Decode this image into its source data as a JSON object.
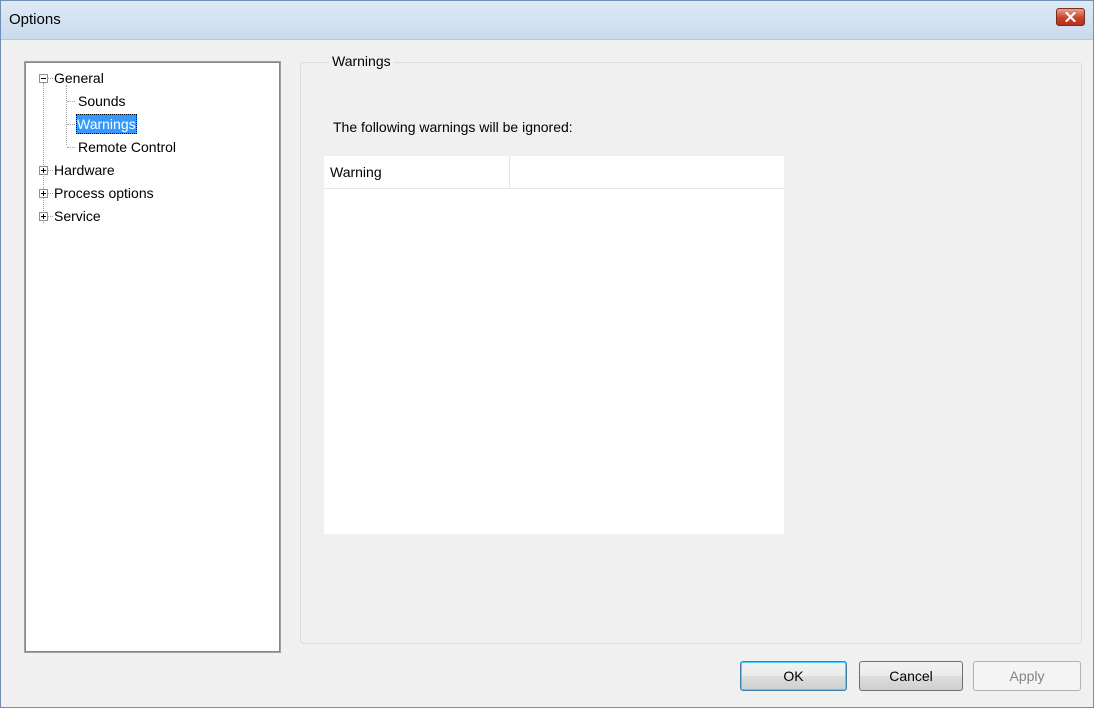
{
  "window": {
    "title": "Options"
  },
  "icons": {
    "close": "close-icon",
    "expand": "plus-box-icon",
    "collapse": "minus-box-icon"
  },
  "tree": {
    "items": [
      {
        "label": "General",
        "level": 0,
        "state": "expanded"
      },
      {
        "label": "Sounds",
        "level": 1
      },
      {
        "label": "Warnings",
        "level": 1,
        "selected": true
      },
      {
        "label": "Remote Control",
        "level": 1
      },
      {
        "label": "Hardware",
        "level": 0,
        "state": "collapsed"
      },
      {
        "label": "Process options",
        "level": 0,
        "state": "collapsed"
      },
      {
        "label": "Service",
        "level": 0,
        "state": "collapsed"
      }
    ]
  },
  "panel": {
    "group_title": "Warnings",
    "description": "The following warnings will be ignored:",
    "list": {
      "columns": [
        "Warning",
        ""
      ],
      "rows": []
    }
  },
  "buttons": {
    "ok": "OK",
    "cancel": "Cancel",
    "apply": "Apply"
  },
  "colors": {
    "selection": "#3399ff",
    "close_button": "#c8432b",
    "dialog_background": "#f0f0f0"
  }
}
